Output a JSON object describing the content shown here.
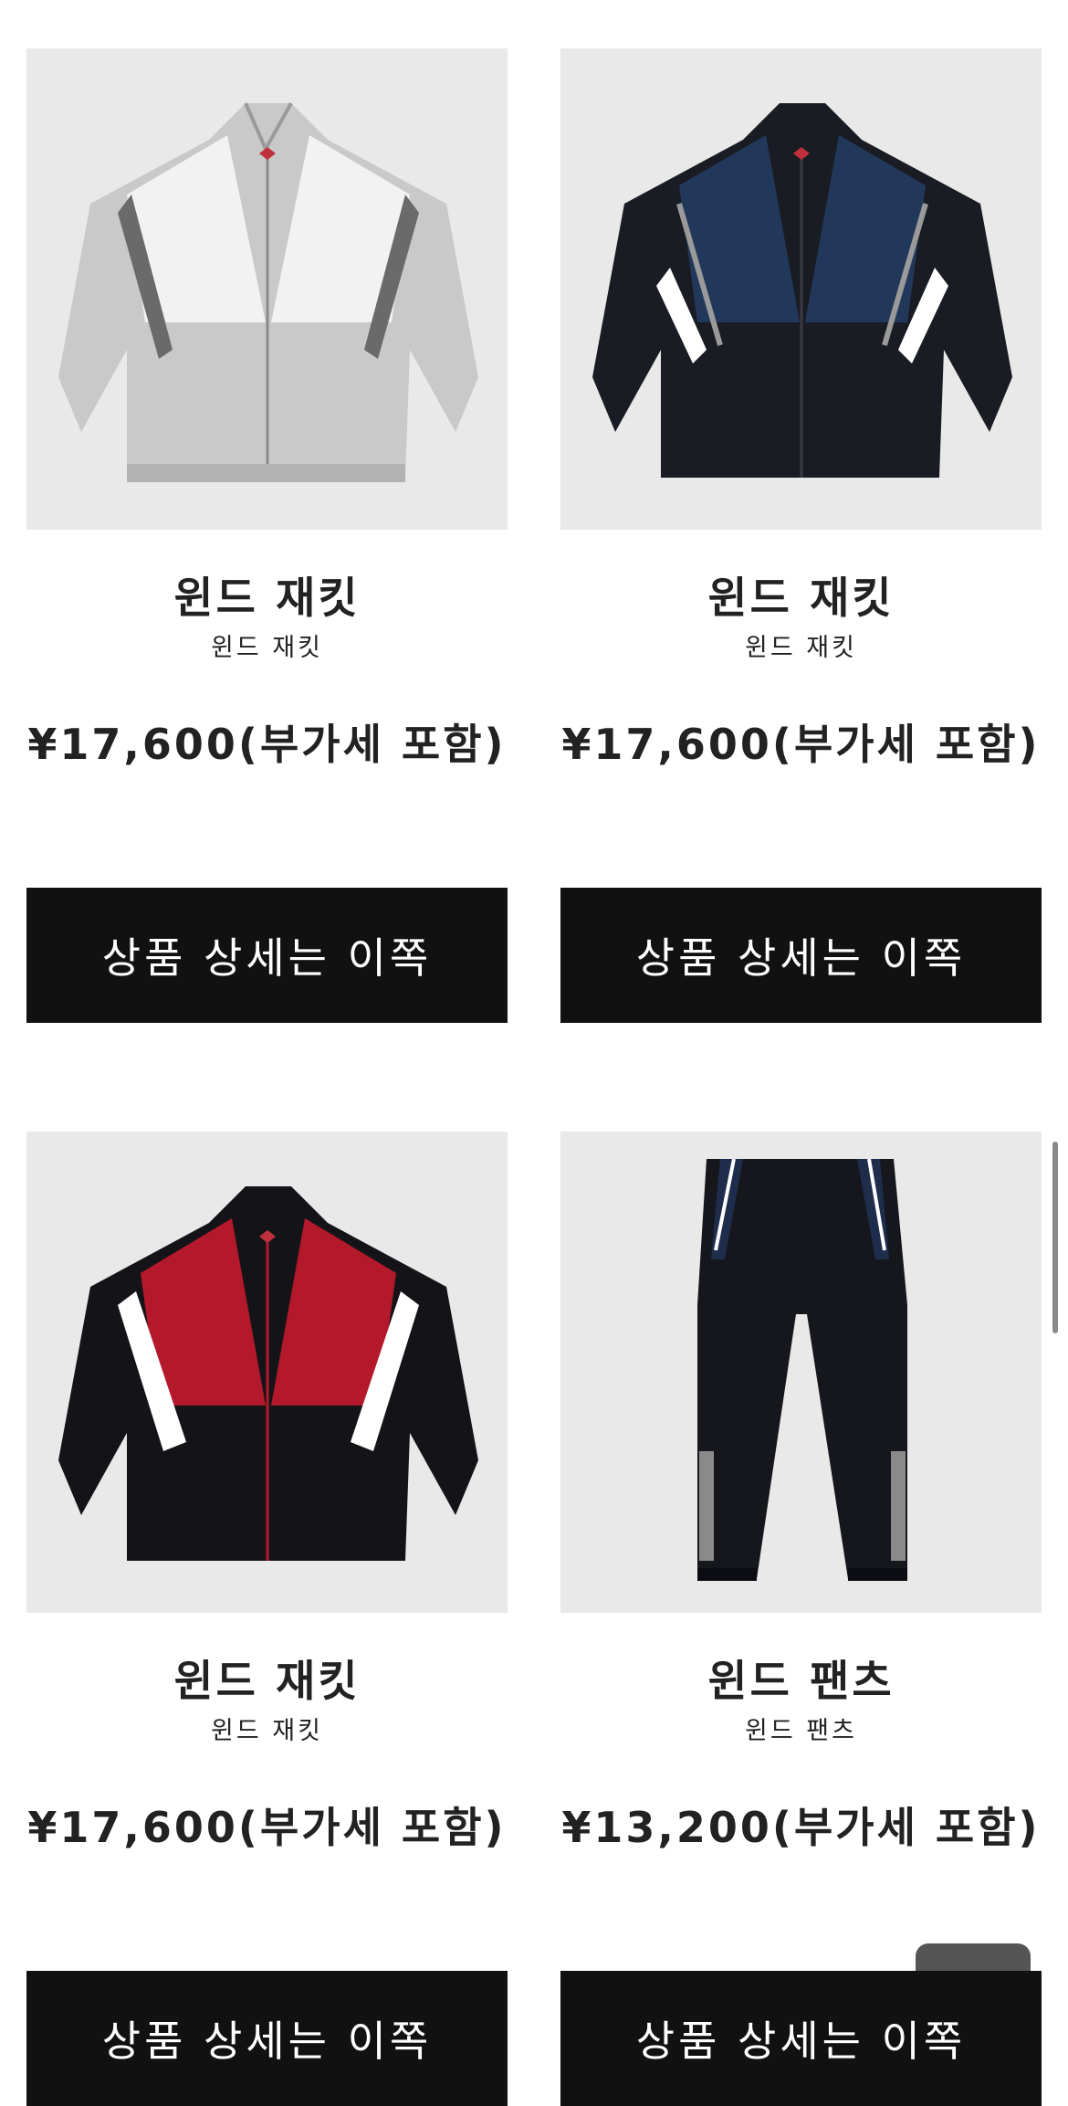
{
  "products": [
    {
      "name": "윈드 재킷",
      "subname": "윈드 재킷",
      "price": "¥17,600(부가세 포함)",
      "button_label": "상품 상세는 이쪽",
      "colors": {
        "body": "#c9c9c9",
        "panel": "#f2f2f2",
        "accent": "#b2b2b2",
        "trim": "#6a6a6a"
      }
    },
    {
      "name": "윈드 재킷",
      "subname": "윈드 재킷",
      "price": "¥17,600(부가세 포함)",
      "button_label": "상품 상세는 이쪽",
      "colors": {
        "body": "#1a1c23",
        "panel": "#22385a",
        "accent": "#ffffff",
        "trim": "#9a9a9a"
      }
    },
    {
      "name": "윈드 재킷",
      "subname": "윈드 재킷",
      "price": "¥17,600(부가세 포함)",
      "button_label": "상품 상세는 이쪽",
      "colors": {
        "body": "#141418",
        "panel": "#b3192a",
        "accent": "#ffffff",
        "trim": "#9a9a9a"
      }
    },
    {
      "name": "윈드 팬츠",
      "subname": "윈드 팬츠",
      "price": "¥13,200(부가세 포함)",
      "button_label": "상품 상세는 이쪽",
      "colors": {
        "body": "#15171d",
        "panel": "#1f2d4d",
        "accent": "#ffffff",
        "trim": "#9a9a9a"
      }
    }
  ],
  "icons": {
    "scroll": "scrollbar-thumb",
    "float": "floating-action-button"
  }
}
